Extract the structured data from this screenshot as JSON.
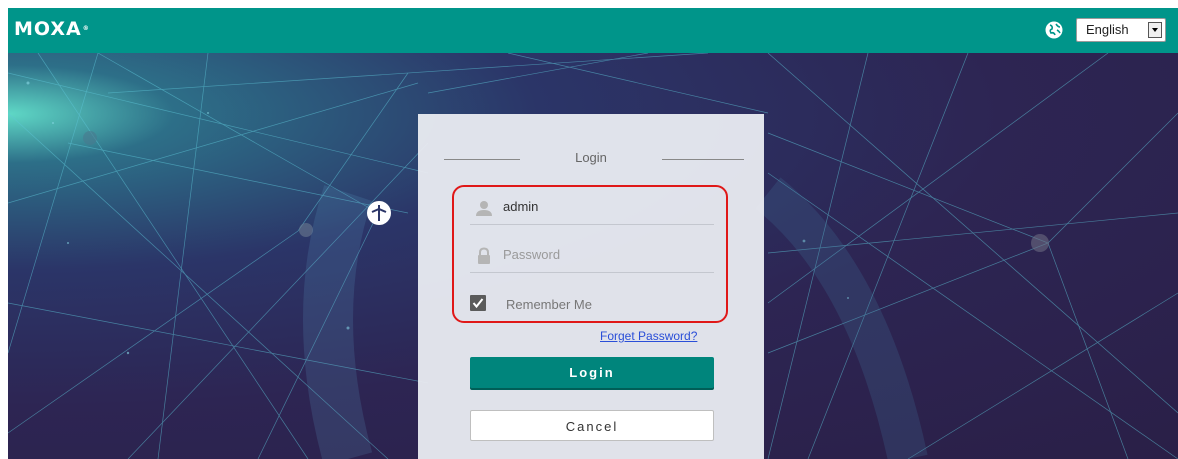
{
  "header": {
    "logo": "MOXA",
    "logo_mark": "®",
    "language": {
      "selected": "English"
    }
  },
  "login": {
    "title": "Login",
    "username": {
      "value": "admin",
      "icon": "user-icon"
    },
    "password": {
      "placeholder": "Password",
      "icon": "lock-icon"
    },
    "remember_me": {
      "label": "Remember Me",
      "checked": true
    },
    "forget_password": "Forget Password?",
    "login_button": "Login",
    "cancel_button": "Cancel"
  },
  "colors": {
    "header": "#00958a",
    "login_button": "#00857c",
    "highlight": "#e01818",
    "link": "#2a4ed8"
  }
}
